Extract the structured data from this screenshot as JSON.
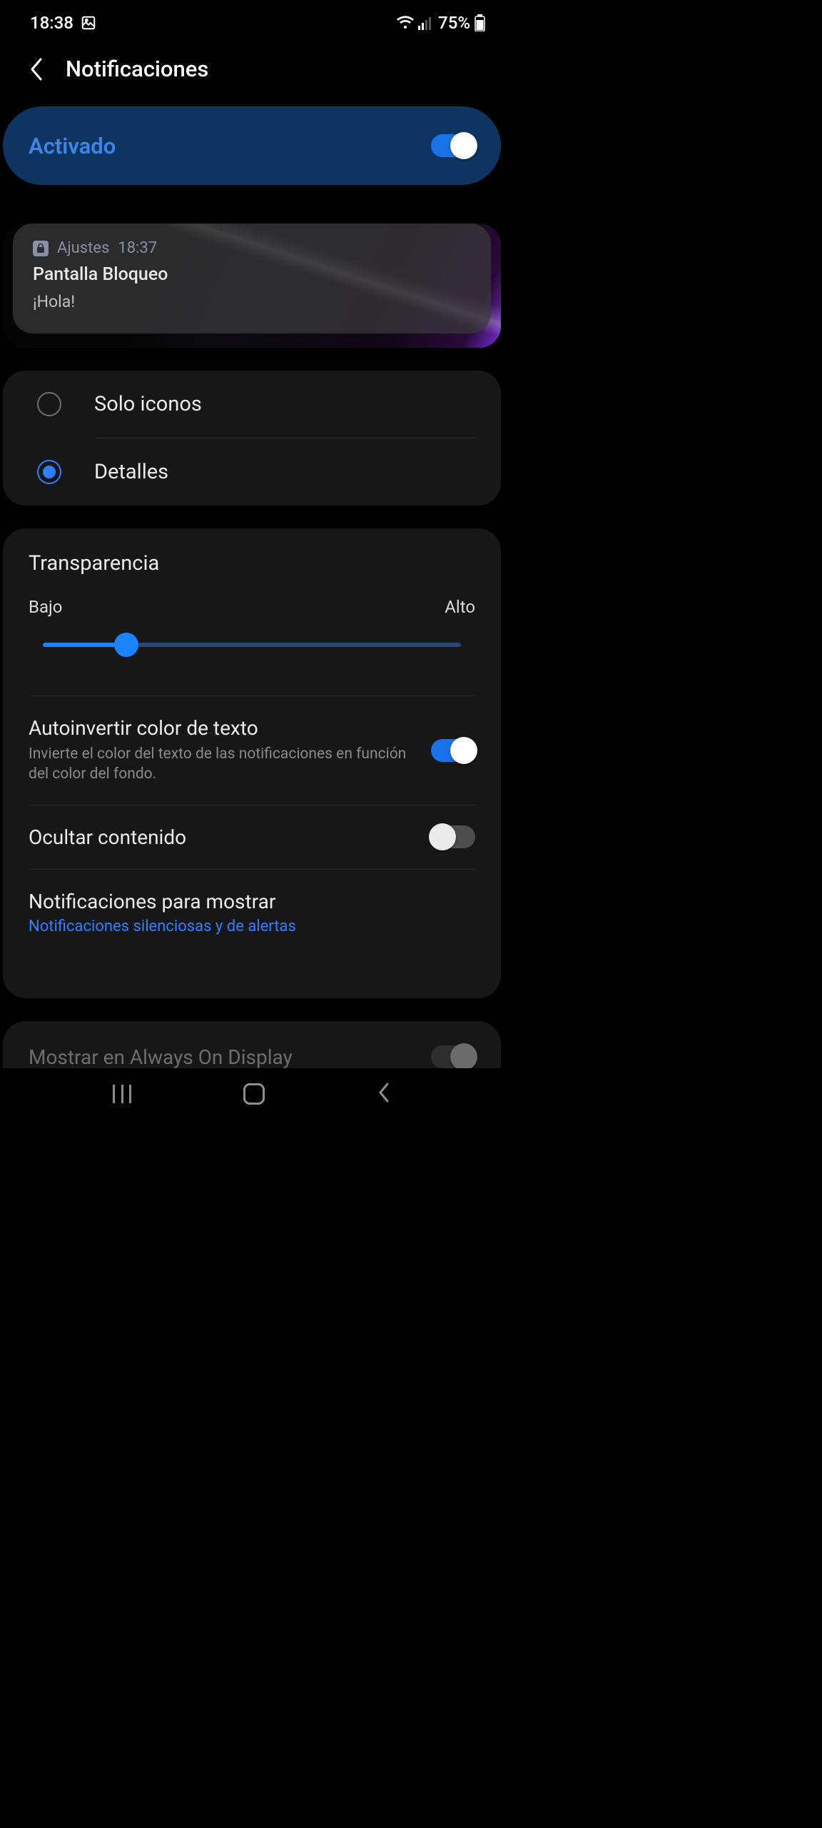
{
  "status": {
    "time": "18:38",
    "battery": "75%"
  },
  "header": {
    "title": "Notificaciones"
  },
  "master": {
    "label": "Activado",
    "on": true
  },
  "preview": {
    "app": "Ajustes",
    "time": "18:37",
    "title": "Pantalla Bloqueo",
    "body": "¡Hola!"
  },
  "view_options": {
    "icons_only": "Solo iconos",
    "details": "Detalles",
    "selected": "details"
  },
  "transparency": {
    "title": "Transparencia",
    "low": "Bajo",
    "high": "Alto",
    "percent": 20
  },
  "auto_invert": {
    "title": "Autoinvertir color de texto",
    "desc": "Invierte el color del texto de las notificaciones en función del color del fondo.",
    "on": true
  },
  "hide_content": {
    "title": "Ocultar contenido",
    "on": false
  },
  "to_show": {
    "title": "Notificaciones para mostrar",
    "value": "Notificaciones silenciosas y de alertas"
  },
  "aod": {
    "title": "Mostrar en Always On Display",
    "on": true,
    "disabled": true
  }
}
